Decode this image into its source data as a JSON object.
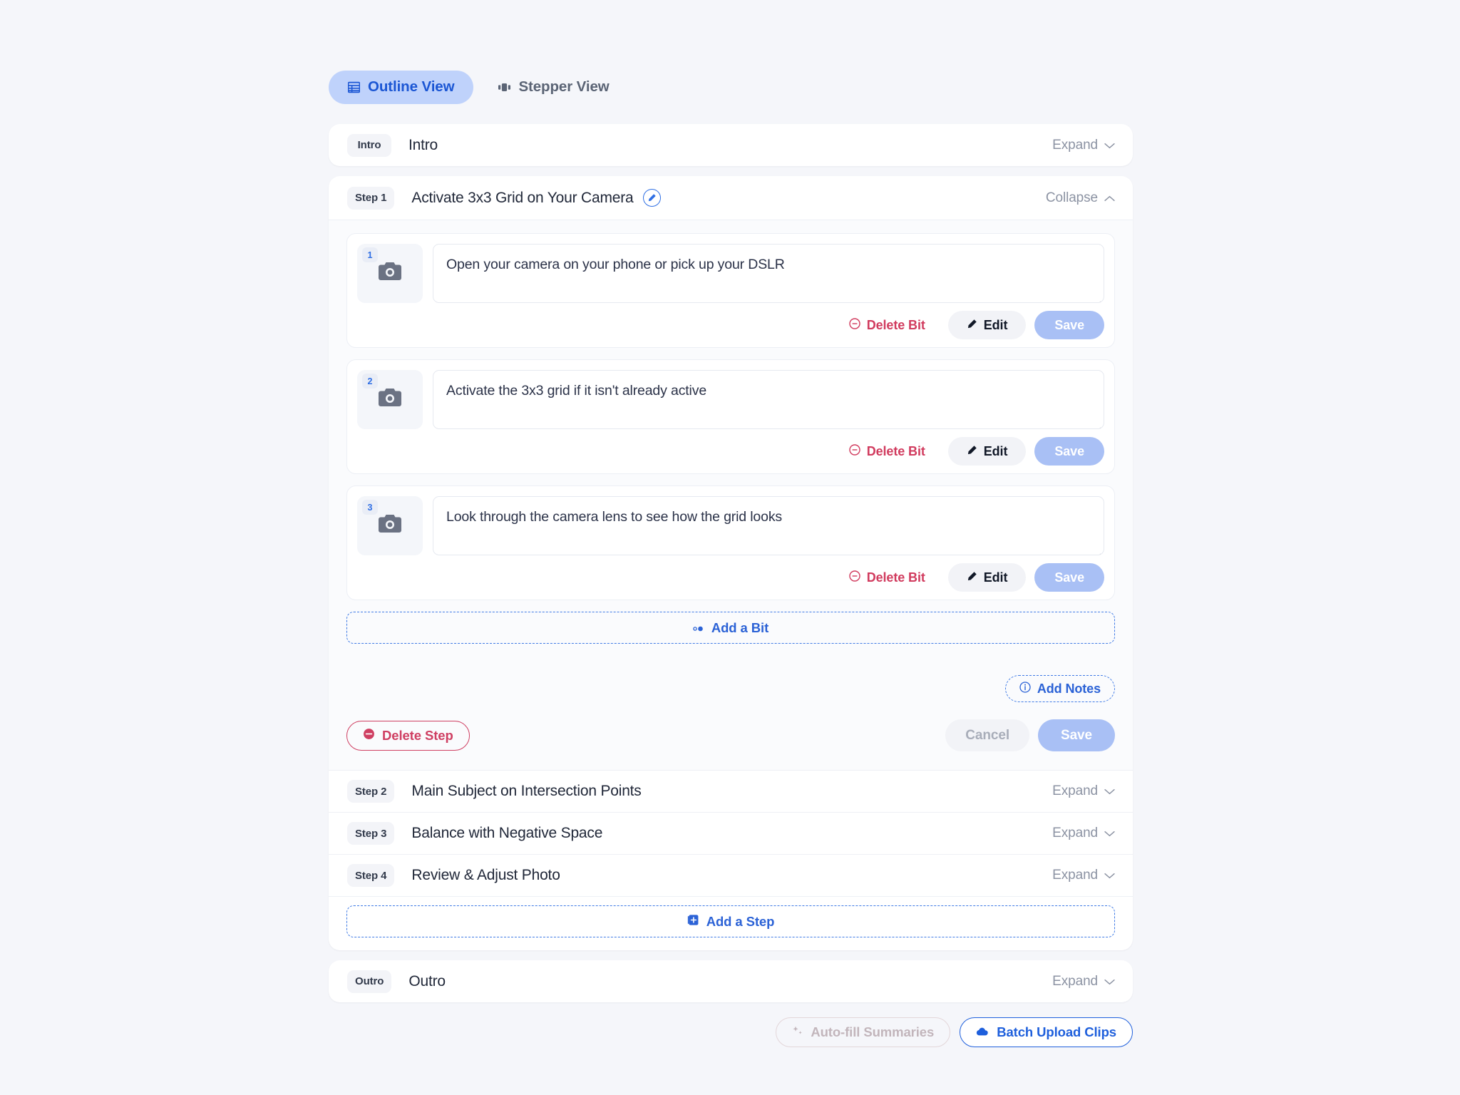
{
  "theme": {
    "page_bg": "#f5f6fa",
    "accent_blue": "#2f6fe4",
    "tab_active_bg": "#bfd2fb",
    "tab_active_text": "#1b56d4",
    "danger_red": "#cf3f62",
    "muted_save_blue": "#a9c0f5"
  },
  "tabs": [
    {
      "label": "Outline View",
      "icon": "grid-icon",
      "active": true
    },
    {
      "label": "Stepper View",
      "icon": "stepper-icon",
      "active": false
    }
  ],
  "intro": {
    "chip": "Intro",
    "title": "Intro",
    "toggle": "Expand"
  },
  "step1": {
    "chip": "Step 1",
    "title": "Activate 3x3 Grid on Your Camera",
    "toggle": "Collapse",
    "edit_icon": "pencil-icon",
    "bits": [
      {
        "number": "1",
        "text": "Open your camera on your phone or pick up your DSLR",
        "thumb_icon": "camera-icon",
        "delete_label": "Delete Bit",
        "edit_label": "Edit",
        "save_label": "Save"
      },
      {
        "number": "2",
        "text": "Activate the 3x3 grid if it isn't already active",
        "thumb_icon": "camera-icon",
        "delete_label": "Delete Bit",
        "edit_label": "Edit",
        "save_label": "Save"
      },
      {
        "number": "3",
        "text": "Look through the camera lens to see how the grid looks",
        "thumb_icon": "camera-icon",
        "delete_label": "Delete Bit",
        "edit_label": "Edit",
        "save_label": "Save"
      }
    ],
    "add_bit_label": "Add a Bit",
    "add_notes_label": "Add Notes",
    "delete_step_label": "Delete Step",
    "cancel_label": "Cancel",
    "save_label": "Save"
  },
  "other_steps": [
    {
      "chip": "Step 2",
      "title": "Main Subject on Intersection Points",
      "toggle": "Expand"
    },
    {
      "chip": "Step 3",
      "title": "Balance with Negative Space",
      "toggle": "Expand"
    },
    {
      "chip": "Step 4",
      "title": "Review & Adjust Photo",
      "toggle": "Expand"
    }
  ],
  "add_step_label": "Add a Step",
  "outro": {
    "chip": "Outro",
    "title": "Outro",
    "toggle": "Expand"
  },
  "bottom": {
    "autofill_label": "Auto-fill Summaries",
    "batch_label": "Batch Upload Clips"
  }
}
